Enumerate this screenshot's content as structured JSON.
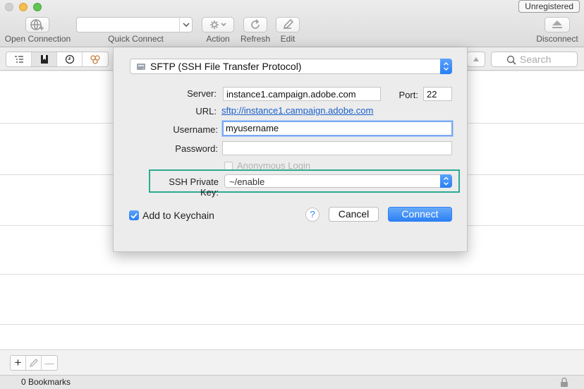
{
  "window": {
    "badge": "Unregistered"
  },
  "toolbar": {
    "open_connection": "Open Connection",
    "quick_connect": "Quick Connect",
    "action": "Action",
    "refresh": "Refresh",
    "edit": "Edit",
    "disconnect": "Disconnect"
  },
  "subbar": {
    "search_placeholder": "Search",
    "view_icons": [
      "outline-list-icon",
      "bookmarks-icon",
      "history-icon",
      "bonjour-icon"
    ]
  },
  "dialog": {
    "protocol": "SFTP (SSH File Transfer Protocol)",
    "server_label": "Server:",
    "server_value": "instance1.campaign.adobe.com",
    "port_label": "Port:",
    "port_value": "22",
    "url_label": "URL:",
    "url_value": "sftp://instance1.campaign.adobe.com",
    "username_label": "Username:",
    "username_value": "myusername",
    "password_label": "Password:",
    "password_value": "",
    "anonymous_label": "Anonymous Login",
    "ssh_key_label": "SSH Private Key:",
    "ssh_key_value": "~/enable",
    "keychain_label": "Add to Keychain",
    "keychain_checked": true,
    "help_label": "?",
    "cancel_label": "Cancel",
    "connect_label": "Connect",
    "highlight_color": "#2bab8f",
    "accent_color": "#2d80f4"
  },
  "bottom": {
    "add_label": "+",
    "remove_label": "—",
    "status": "0 Bookmarks"
  }
}
